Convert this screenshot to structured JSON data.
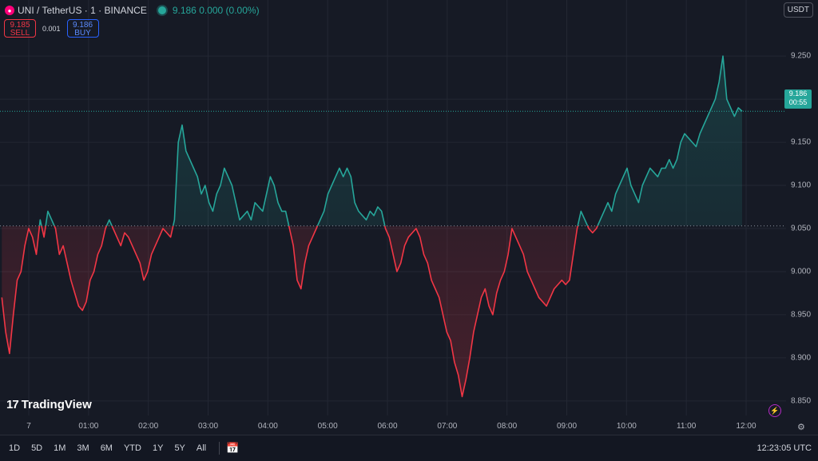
{
  "header": {
    "logo_glyph": "●",
    "symbol": "UNI / TetherUS · 1 · BINANCE",
    "ohlc": "9.186  0.000 (0.00%)"
  },
  "trade": {
    "sell_price": "9.185",
    "sell_label": "SELL",
    "spread": "0.001",
    "buy_price": "9.186",
    "buy_label": "BUY"
  },
  "currency_button": "USDT",
  "current_price": {
    "value": "9.186",
    "countdown": "00:55"
  },
  "branding": {
    "logo_mark": "17",
    "name": "TradingView"
  },
  "bottom_bar": {
    "ranges": [
      "1D",
      "5D",
      "1M",
      "3M",
      "6M",
      "YTD",
      "1Y",
      "5Y",
      "All"
    ],
    "clock": "12:23:05 UTC"
  },
  "icons": {
    "calendar": "calendar-range-icon",
    "settings": "gear-icon",
    "alerts": "lightning-icon"
  },
  "colors": {
    "up": "#26a69a",
    "down": "#f23645",
    "background": "#161a25"
  },
  "chart_data": {
    "type": "area",
    "title": "",
    "baseline": 9.053,
    "last_price": 9.186,
    "ylim": [
      8.835,
      9.29
    ],
    "y_ticks": [
      9.25,
      9.2,
      9.15,
      9.1,
      9.05,
      9.0,
      8.95,
      8.9,
      8.85
    ],
    "y_tick_labels": [
      "9.250",
      "9.200",
      "9.150",
      "9.100",
      "9.050",
      "9.000",
      "8.950",
      "8.900",
      "8.850"
    ],
    "x_tick_labels": [
      "7",
      "01:00",
      "02:00",
      "03:00",
      "04:00",
      "05:00",
      "06:00",
      "07:00",
      "08:00",
      "09:00",
      "10:00",
      "11:00",
      "12:00"
    ],
    "x_tick_minutes": [
      0,
      60,
      120,
      180,
      240,
      300,
      360,
      420,
      480,
      540,
      600,
      660,
      720
    ],
    "x_start_minutes": -27,
    "x_end_minutes": 716,
    "series": [
      {
        "values": [
          8.97,
          8.93,
          8.905,
          8.95,
          8.99,
          9.0,
          9.03,
          9.05,
          9.04,
          9.02,
          9.06,
          9.04,
          9.07,
          9.06,
          9.05,
          9.02,
          9.03,
          9.01,
          8.99,
          8.975,
          8.96,
          8.955,
          8.965,
          8.99,
          9.0,
          9.02,
          9.03,
          9.05,
          9.06,
          9.05,
          9.04,
          9.03,
          9.045,
          9.04,
          9.03,
          9.02,
          9.01,
          8.99,
          9.0,
          9.02,
          9.03,
          9.04,
          9.05,
          9.045,
          9.04,
          9.06,
          9.15,
          9.17,
          9.14,
          9.13,
          9.12,
          9.11,
          9.09,
          9.1,
          9.08,
          9.07,
          9.09,
          9.1,
          9.12,
          9.11,
          9.1,
          9.08,
          9.06,
          9.065,
          9.07,
          9.06,
          9.08,
          9.075,
          9.07,
          9.09,
          9.11,
          9.1,
          9.08,
          9.07,
          9.07,
          9.05,
          9.03,
          8.99,
          8.98,
          9.01,
          9.03,
          9.04,
          9.05,
          9.06,
          9.07,
          9.09,
          9.1,
          9.11,
          9.12,
          9.11,
          9.12,
          9.11,
          9.08,
          9.07,
          9.065,
          9.06,
          9.07,
          9.065,
          9.075,
          9.07,
          9.05,
          9.04,
          9.02,
          9.0,
          9.01,
          9.03,
          9.04,
          9.045,
          9.05,
          9.04,
          9.02,
          9.01,
          8.99,
          8.98,
          8.97,
          8.95,
          8.93,
          8.92,
          8.895,
          8.88,
          8.855,
          8.875,
          8.9,
          8.93,
          8.95,
          8.97,
          8.98,
          8.96,
          8.95,
          8.975,
          8.99,
          9.0,
          9.02,
          9.05,
          9.04,
          9.03,
          9.02,
          9.0,
          8.99,
          8.98,
          8.97,
          8.965,
          8.96,
          8.97,
          8.98,
          8.985,
          8.99,
          8.985,
          8.99,
          9.02,
          9.05,
          9.07,
          9.06,
          9.05,
          9.045,
          9.05,
          9.06,
          9.07,
          9.08,
          9.07,
          9.09,
          9.1,
          9.11,
          9.12,
          9.1,
          9.09,
          9.08,
          9.1,
          9.11,
          9.12,
          9.115,
          9.11,
          9.12,
          9.12,
          9.13,
          9.12,
          9.13,
          9.15,
          9.16,
          9.155,
          9.15,
          9.145,
          9.16,
          9.17,
          9.18,
          9.19,
          9.2,
          9.22,
          9.25,
          9.2,
          9.19,
          9.18,
          9.19,
          9.186
        ]
      }
    ]
  }
}
